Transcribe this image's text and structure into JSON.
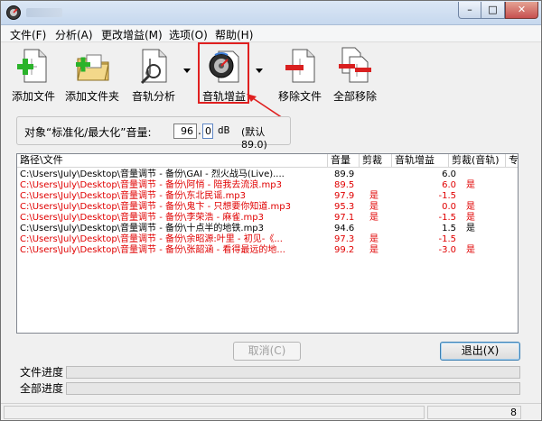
{
  "menu": [
    "文件(F)",
    "分析(A)",
    "更改增益(M)",
    "选项(O)",
    "帮助(H)"
  ],
  "toolbar": {
    "add_file": "添加文件",
    "add_folder": "添加文件夹",
    "track_analysis": "音轨分析",
    "track_gain": "音轨增益",
    "remove_file": "移除文件",
    "remove_all": "全部移除"
  },
  "target": {
    "label": "对象“标准化/最大化”音量:",
    "volume": "96",
    "dot": ".",
    "decimal": "0",
    "unit": "dB",
    "default_text": "(默认 89.0)"
  },
  "table": {
    "columns": [
      "路径\\文件",
      "音量",
      "剪裁",
      "音轨增益",
      "剪裁(音轨)",
      "专"
    ],
    "rows": [
      {
        "path": "C:\\Users\\July\\Desktop\\音量调节 - 备份\\GAI - 烈火战马(Live)....",
        "volume": "89.9",
        "clipping": "",
        "track_gain": "6.0",
        "track_clip": "",
        "red": false
      },
      {
        "path": "C:\\Users\\July\\Desktop\\音量调节 - 备份\\阿悄 - 陪我去流浪.mp3",
        "volume": "89.5",
        "clipping": "",
        "track_gain": "6.0",
        "track_clip": "是",
        "red": true
      },
      {
        "path": "C:\\Users\\July\\Desktop\\音量调节 - 备份\\东北民谣.mp3",
        "volume": "97.9",
        "clipping": "是",
        "track_gain": "-1.5",
        "track_clip": "",
        "red": true
      },
      {
        "path": "C:\\Users\\July\\Desktop\\音量调节 - 备份\\鬼卞 - 只想要你知道.mp3",
        "volume": "95.3",
        "clipping": "是",
        "track_gain": "0.0",
        "track_clip": "是",
        "red": true
      },
      {
        "path": "C:\\Users\\July\\Desktop\\音量调节 - 备份\\李荣浩 - 麻雀.mp3",
        "volume": "97.1",
        "clipping": "是",
        "track_gain": "-1.5",
        "track_clip": "是",
        "red": true
      },
      {
        "path": "C:\\Users\\July\\Desktop\\音量调节 - 备份\\十点半的地铁.mp3",
        "volume": "94.6",
        "clipping": "",
        "track_gain": "1.5",
        "track_clip": "是",
        "red": false
      },
      {
        "path": "C:\\Users\\July\\Desktop\\音量调节 - 备份\\余昭源:叶里 - 初见-《...",
        "volume": "97.3",
        "clipping": "是",
        "track_gain": "-1.5",
        "track_clip": "",
        "red": true
      },
      {
        "path": "C:\\Users\\July\\Desktop\\音量调节 - 备份\\张韶涵 - 看得最远的地...",
        "volume": "99.2",
        "clipping": "是",
        "track_gain": "-3.0",
        "track_clip": "是",
        "red": true
      }
    ]
  },
  "buttons": {
    "cancel": "取消(C)",
    "exit": "退出(X)"
  },
  "progress": {
    "file_label": "文件进度",
    "all_label": "全部进度",
    "file_value": 0,
    "all_value": 0
  },
  "status": {
    "count": "8"
  },
  "colors": {
    "warning": "#e00000",
    "highlight": "#e02020"
  }
}
